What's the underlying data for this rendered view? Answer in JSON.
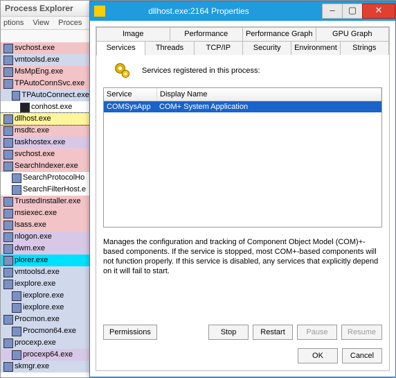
{
  "bg": {
    "title": "Process Explorer",
    "menu": [
      "ptions",
      "View",
      "Proces"
    ],
    "tree": [
      {
        "label": "svchost.exe",
        "cls": "c-pink",
        "ind": 0,
        "icon": "svc"
      },
      {
        "label": "vmtoolsd.exe",
        "cls": "c-blue",
        "ind": 0,
        "icon": "svc"
      },
      {
        "label": "MsMpEng.exe",
        "cls": "c-pink",
        "ind": 0,
        "icon": "svc"
      },
      {
        "label": "TPAutoConnSvc.exe",
        "cls": "c-pink",
        "ind": 0,
        "icon": "svc"
      },
      {
        "label": "TPAutoConnect.exe",
        "cls": "c-blue",
        "ind": 1,
        "icon": "svc"
      },
      {
        "label": "conhost.exe",
        "cls": "",
        "ind": 2,
        "icon": "con"
      },
      {
        "label": "dllhost.exe",
        "cls": "c-yel",
        "ind": 0,
        "icon": "svc",
        "sel": true
      },
      {
        "label": "msdtc.exe",
        "cls": "c-pink",
        "ind": 0,
        "icon": "svc"
      },
      {
        "label": "taskhostex.exe",
        "cls": "c-pur",
        "ind": 0,
        "icon": "svc"
      },
      {
        "label": "svchost.exe",
        "cls": "c-pink",
        "ind": 0,
        "icon": "svc"
      },
      {
        "label": "SearchIndexer.exe",
        "cls": "c-pink",
        "ind": 0,
        "icon": "svc"
      },
      {
        "label": "SearchProtocolHo",
        "cls": "",
        "ind": 1,
        "icon": "svc"
      },
      {
        "label": "SearchFilterHost.e",
        "cls": "",
        "ind": 1,
        "icon": "svc"
      },
      {
        "label": "TrustedInstaller.exe",
        "cls": "c-pink",
        "ind": 0,
        "icon": "svc"
      },
      {
        "label": "msiexec.exe",
        "cls": "c-pink",
        "ind": 0,
        "icon": "svc"
      },
      {
        "label": "lsass.exe",
        "cls": "c-pink",
        "ind": 0,
        "icon": "svc"
      },
      {
        "label": "nlogon.exe",
        "cls": "c-pur",
        "ind": 0,
        "icon": "svc"
      },
      {
        "label": "dwm.exe",
        "cls": "c-pur",
        "ind": 0,
        "icon": "svc"
      },
      {
        "label": "plorer.exe",
        "cls": "c-cyan",
        "ind": 0,
        "icon": "svc"
      },
      {
        "label": "vmtoolsd.exe",
        "cls": "c-blue",
        "ind": 0,
        "icon": "svc"
      },
      {
        "label": "iexplore.exe",
        "cls": "c-blue",
        "ind": 0,
        "icon": "svc"
      },
      {
        "label": "iexplore.exe",
        "cls": "c-blue",
        "ind": 1,
        "icon": "svc"
      },
      {
        "label": "iexplore.exe",
        "cls": "c-blue",
        "ind": 1,
        "icon": "svc"
      },
      {
        "label": "Procmon.exe",
        "cls": "c-blue",
        "ind": 0,
        "icon": "svc"
      },
      {
        "label": "Procmon64.exe",
        "cls": "c-blue",
        "ind": 1,
        "icon": "svc"
      },
      {
        "label": "procexp.exe",
        "cls": "c-blue",
        "ind": 0,
        "icon": "svc"
      },
      {
        "label": "procexp64.exe",
        "cls": "c-pur",
        "ind": 1,
        "icon": "svc"
      },
      {
        "label": "skmgr.exe",
        "cls": "c-blue",
        "ind": 0,
        "icon": "svc"
      }
    ]
  },
  "dlg": {
    "title": "dllhost.exe:2164 Properties",
    "tabs_row1": [
      "Image",
      "Performance",
      "Performance Graph",
      "GPU Graph"
    ],
    "tabs_row2": [
      "Services",
      "Threads",
      "TCP/IP",
      "Security",
      "Environment",
      "Strings"
    ],
    "selected_tab": "Services",
    "header": "Services registered in this process:",
    "cols": {
      "svc": "Service",
      "dn": "Display Name"
    },
    "rows": [
      {
        "svc": "COMSysApp",
        "dn": "COM+ System Application",
        "sel": true
      }
    ],
    "desc": "Manages the configuration and tracking of Component Object Model (COM)+-based components. If the service is stopped, most COM+-based components will not function properly. If this service is disabled, any services that explicitly depend on it will fail to start.",
    "btns": {
      "perm": "Permissions",
      "stop": "Stop",
      "restart": "Restart",
      "pause": "Pause",
      "resume": "Resume",
      "ok": "OK",
      "cancel": "Cancel"
    }
  }
}
